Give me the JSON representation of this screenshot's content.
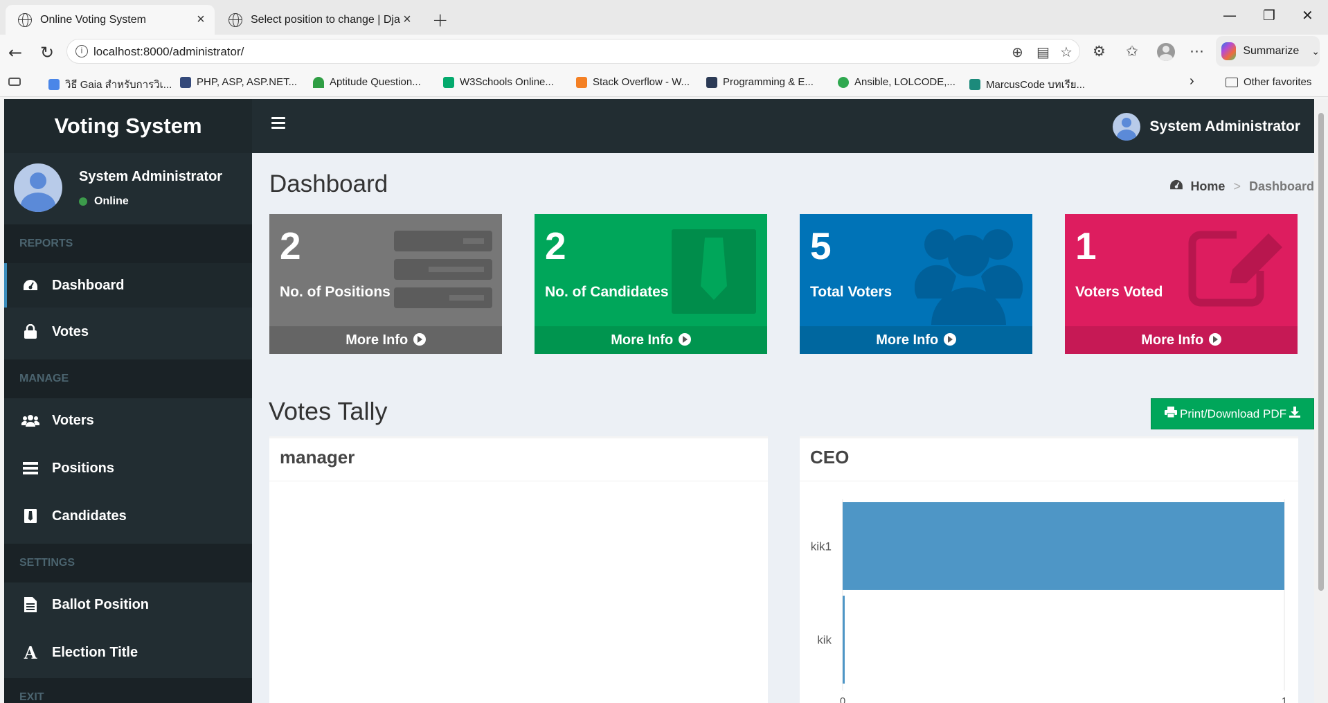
{
  "browser": {
    "tabs": [
      {
        "title": "Online Voting System"
      },
      {
        "title": "Select position to change | Django"
      }
    ],
    "url": "localhost:8000/administrator/",
    "summarize_label": "Summarize",
    "bookmarks": [
      "วิธี Gaia สำหรับการวิเ...",
      "PHP, ASP, ASP.NET...",
      "Aptitude Question...",
      "W3Schools Online...",
      "Stack Overflow - W...",
      "Programming & E...",
      "Ansible, LOLCODE,...",
      "MarcusCode บทเรีย..."
    ],
    "other_favorites": "Other favorites"
  },
  "app": {
    "logo": "Voting System",
    "header_user": "System Administrator",
    "sidebar": {
      "user_name": "System Administrator",
      "user_status": "Online",
      "sections": {
        "reports": "REPORTS",
        "manage": "MANAGE",
        "settings": "SETTINGS",
        "exit": "EXIT"
      },
      "items": {
        "dashboard": "Dashboard",
        "votes": "Votes",
        "voters": "Voters",
        "positions": "Positions",
        "candidates": "Candidates",
        "ballot_position": "Ballot Position",
        "election_title": "Election Title"
      }
    },
    "content": {
      "page_title": "Dashboard",
      "breadcrumb": {
        "home": "Home",
        "current": "Dashboard"
      },
      "boxes": [
        {
          "value": "2",
          "label": "No. of Positions",
          "more": "More Info",
          "color": "#777777",
          "footer": "#656565"
        },
        {
          "value": "2",
          "label": "No. of Candidates",
          "more": "More Info",
          "color": "#00a65a",
          "footer": "#00954f"
        },
        {
          "value": "5",
          "label": "Total Voters",
          "more": "More Info",
          "color": "#0073b7",
          "footer": "#00679f"
        },
        {
          "value": "1",
          "label": "Voters Voted",
          "more": "More Info",
          "color": "#dd1d5f",
          "footer": "#c61955"
        }
      ],
      "tally_title": "Votes Tally",
      "pdf_button": "Print/Download PDF",
      "panels": {
        "left": "manager",
        "right": "CEO"
      }
    }
  },
  "chart_data": {
    "type": "bar",
    "orientation": "horizontal",
    "title": "CEO",
    "categories": [
      "kik1",
      "kik"
    ],
    "values": [
      1,
      0
    ],
    "xlim": [
      0,
      1
    ],
    "x_ticks": [
      "0",
      "1"
    ],
    "color": "#4e96c6"
  }
}
